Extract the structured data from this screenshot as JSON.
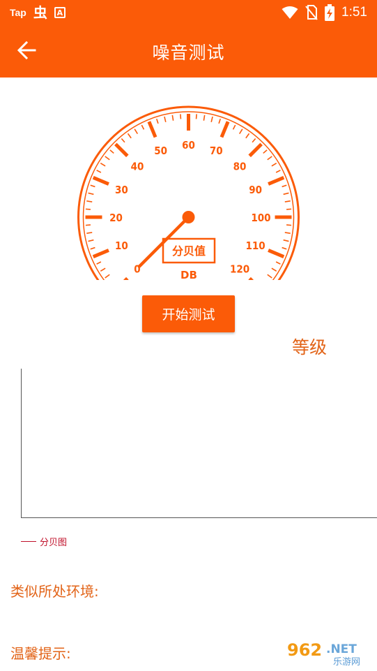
{
  "status_bar": {
    "left_items": [
      "Tap",
      "虫",
      "A"
    ],
    "time": "1:51",
    "icons": [
      "wifi-icon",
      "no-sim-icon",
      "battery-charging-icon"
    ]
  },
  "app_bar": {
    "title": "噪音测试",
    "back_icon": "arrow-left-icon"
  },
  "gauge": {
    "scale_labels": [
      "0",
      "10",
      "20",
      "30",
      "40",
      "50",
      "60",
      "70",
      "80",
      "90",
      "100",
      "110",
      "120"
    ],
    "value_label": "分贝值",
    "unit": "DB",
    "current_value": 0,
    "min": 0,
    "max": 120,
    "accent_color": "#fb5b08"
  },
  "actions": {
    "start_label": "开始测试"
  },
  "level": {
    "label": "等级"
  },
  "chart_data": {
    "type": "line",
    "series": [
      {
        "name": "分贝图",
        "values": []
      }
    ],
    "x": [],
    "title": "",
    "xlabel": "",
    "ylabel": "",
    "grid": false,
    "legend": "bottom-left",
    "color": "#c0102a"
  },
  "info": {
    "environment_label": "类似所处环境:",
    "tip_label": "温馨提示:"
  },
  "watermark": {
    "number": "962",
    "suffix": ".NET",
    "subtitle": "乐游网"
  }
}
